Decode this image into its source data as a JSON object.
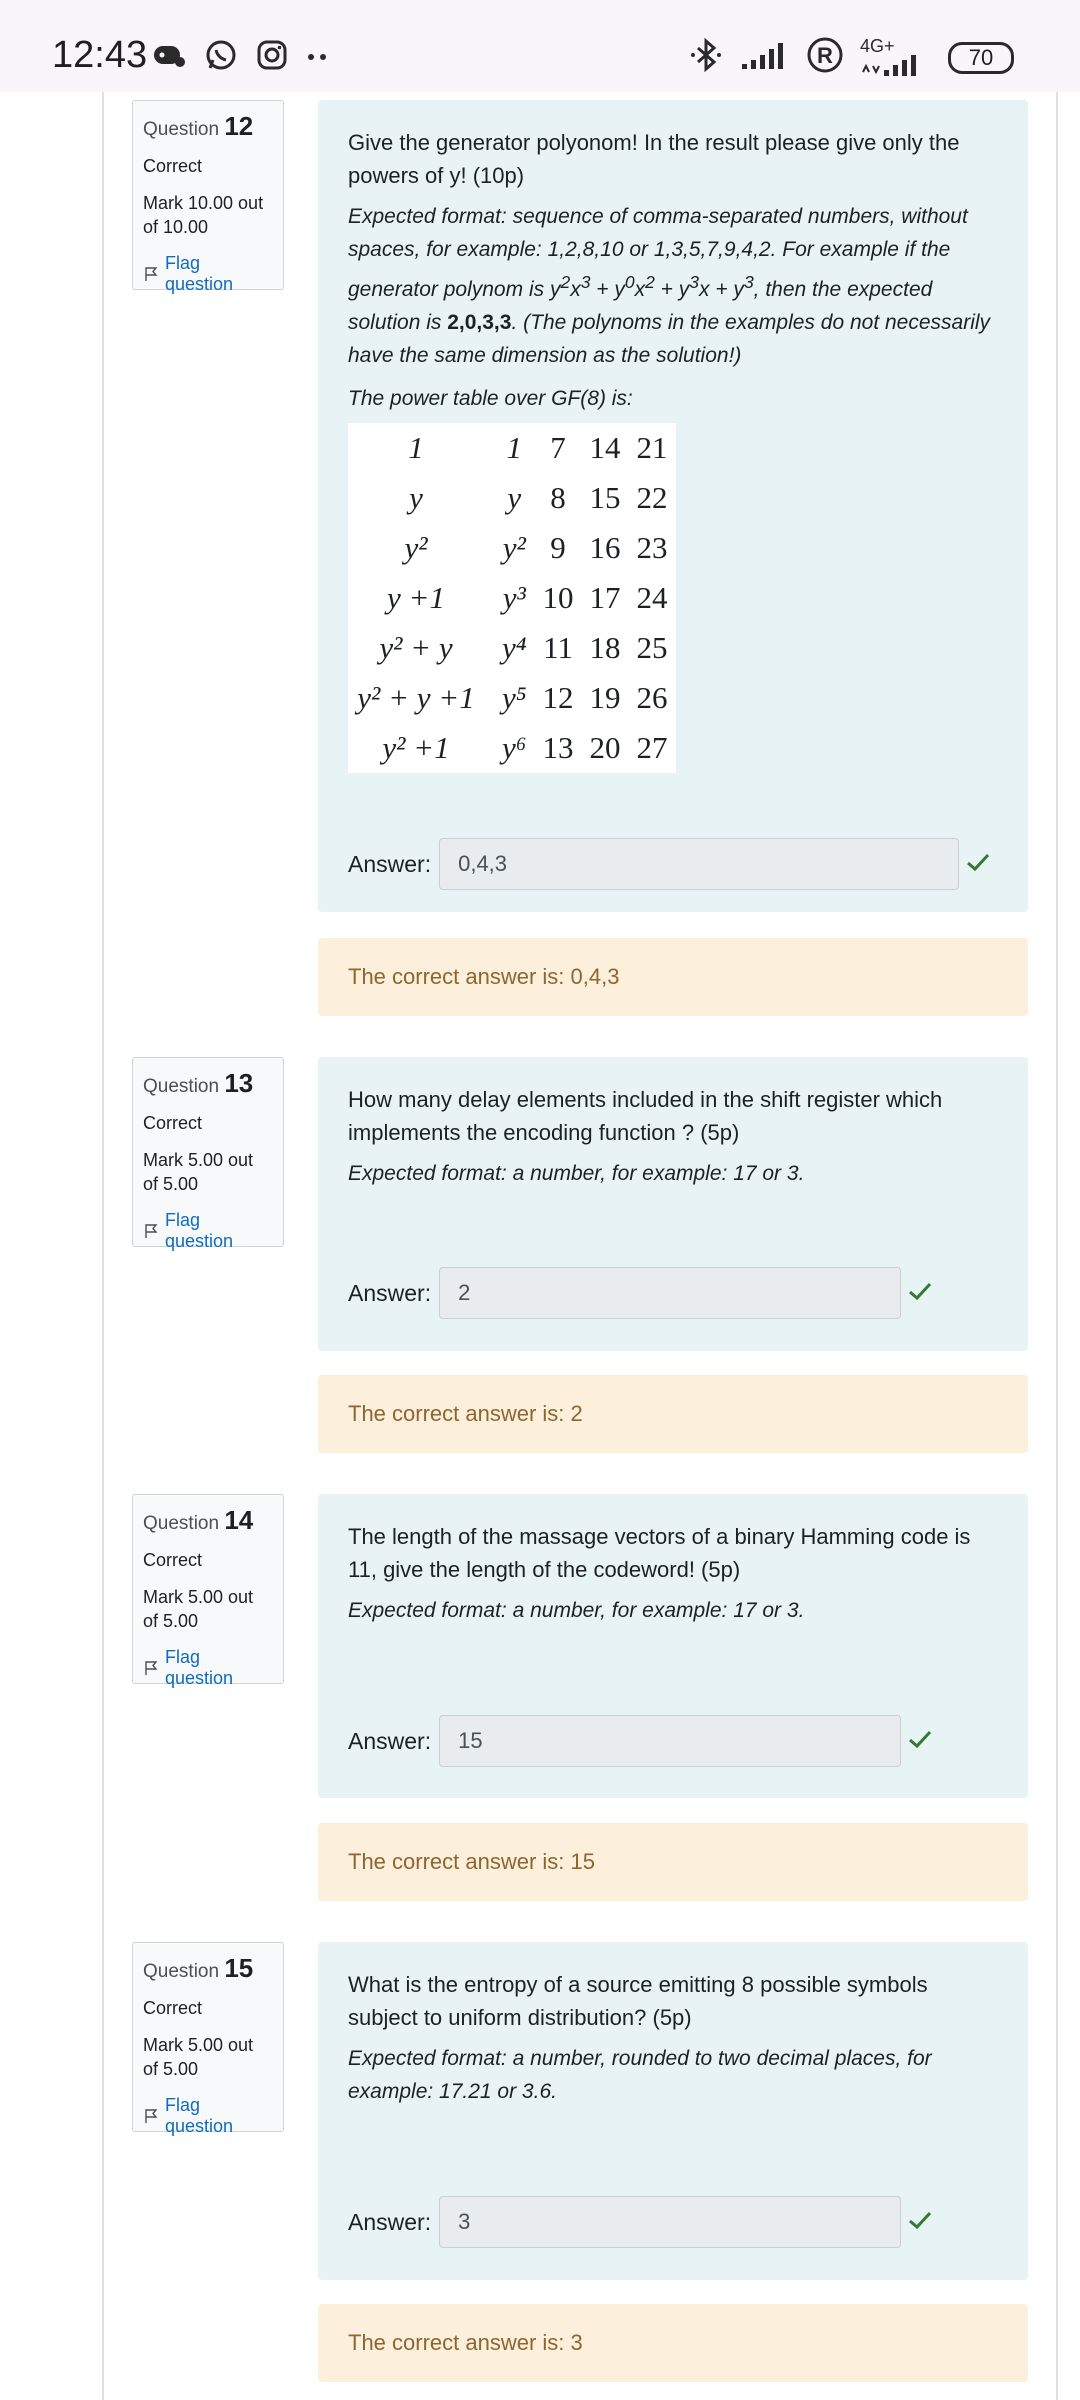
{
  "statusbar": {
    "time": "12:43",
    "network": "4G+",
    "battery": "70"
  },
  "questions": [
    {
      "label": "Question",
      "number": "12",
      "state": "Correct",
      "mark": "Mark 10.00 out of 10.00",
      "flag": "Flag question",
      "text": "Give the generator polyonom! In the result please give only the powers of y! (10p)",
      "format_pre": "Expected format: sequence of comma-separated numbers, without spaces, for example: 1,2,8,10 or 1,3,5,7,9,4,2. For example if the generator polynom is y",
      "format_bold": "2,0,3,3",
      "format_post": ". (The polynoms in the examples do not necessarily have the same dimension as the solution!)",
      "table_intro": "The power table over GF(8) is:",
      "answer_label": "Answer:",
      "answer": "0,4,3",
      "feedback": "The correct answer is: 0,4,3"
    },
    {
      "label": "Question",
      "number": "13",
      "state": "Correct",
      "mark": "Mark 5.00 out of 5.00",
      "flag": "Flag question",
      "text": "How many delay elements included in the shift register which implements the encoding function ?  (5p)",
      "format": "Expected format: a number, for example: 17 or 3.",
      "answer_label": "Answer:",
      "answer": "2",
      "feedback": "The correct answer is: 2"
    },
    {
      "label": "Question",
      "number": "14",
      "state": "Correct",
      "mark": "Mark 5.00 out of 5.00",
      "flag": "Flag question",
      "text": "The length of the massage vectors of a binary Hamming code is 11, give the length of the codeword! (5p)",
      "format": "Expected format: a number, for example: 17 or 3.",
      "answer_label": "Answer:",
      "answer": "15",
      "feedback": "The correct answer is: 15"
    },
    {
      "label": "Question",
      "number": "15",
      "state": "Correct",
      "mark": "Mark 5.00 out of 5.00",
      "flag": "Flag question",
      "text": "What is the entropy of a source emitting 8 possible symbols subject to uniform distribution? (5p)",
      "format": "Expected format: a number, rounded to two decimal places, for example: 17.21 or 3.6.",
      "answer_label": "Answer:",
      "answer": "3",
      "feedback": "The correct answer is: 3"
    }
  ],
  "power_table": {
    "rows": [
      [
        "1",
        "1",
        "7",
        "14",
        "21"
      ],
      [
        "y",
        "y",
        "8",
        "15",
        "22"
      ],
      [
        "y²",
        "y²",
        "9",
        "16",
        "23"
      ],
      [
        "y +1",
        "y³",
        "10",
        "17",
        "24"
      ],
      [
        "y² + y",
        "y⁴",
        "11",
        "18",
        "25"
      ],
      [
        "y² + y +1",
        "y⁵",
        "12",
        "19",
        "26"
      ],
      [
        "y² +1",
        "y⁶",
        "13",
        "20",
        "27"
      ]
    ]
  },
  "colors": {
    "content_bg": "#e7f3f5",
    "feedback_bg": "#fcefdc",
    "feedback_text": "#8e662e",
    "link": "#0f6cbf",
    "check": "#357a32"
  }
}
